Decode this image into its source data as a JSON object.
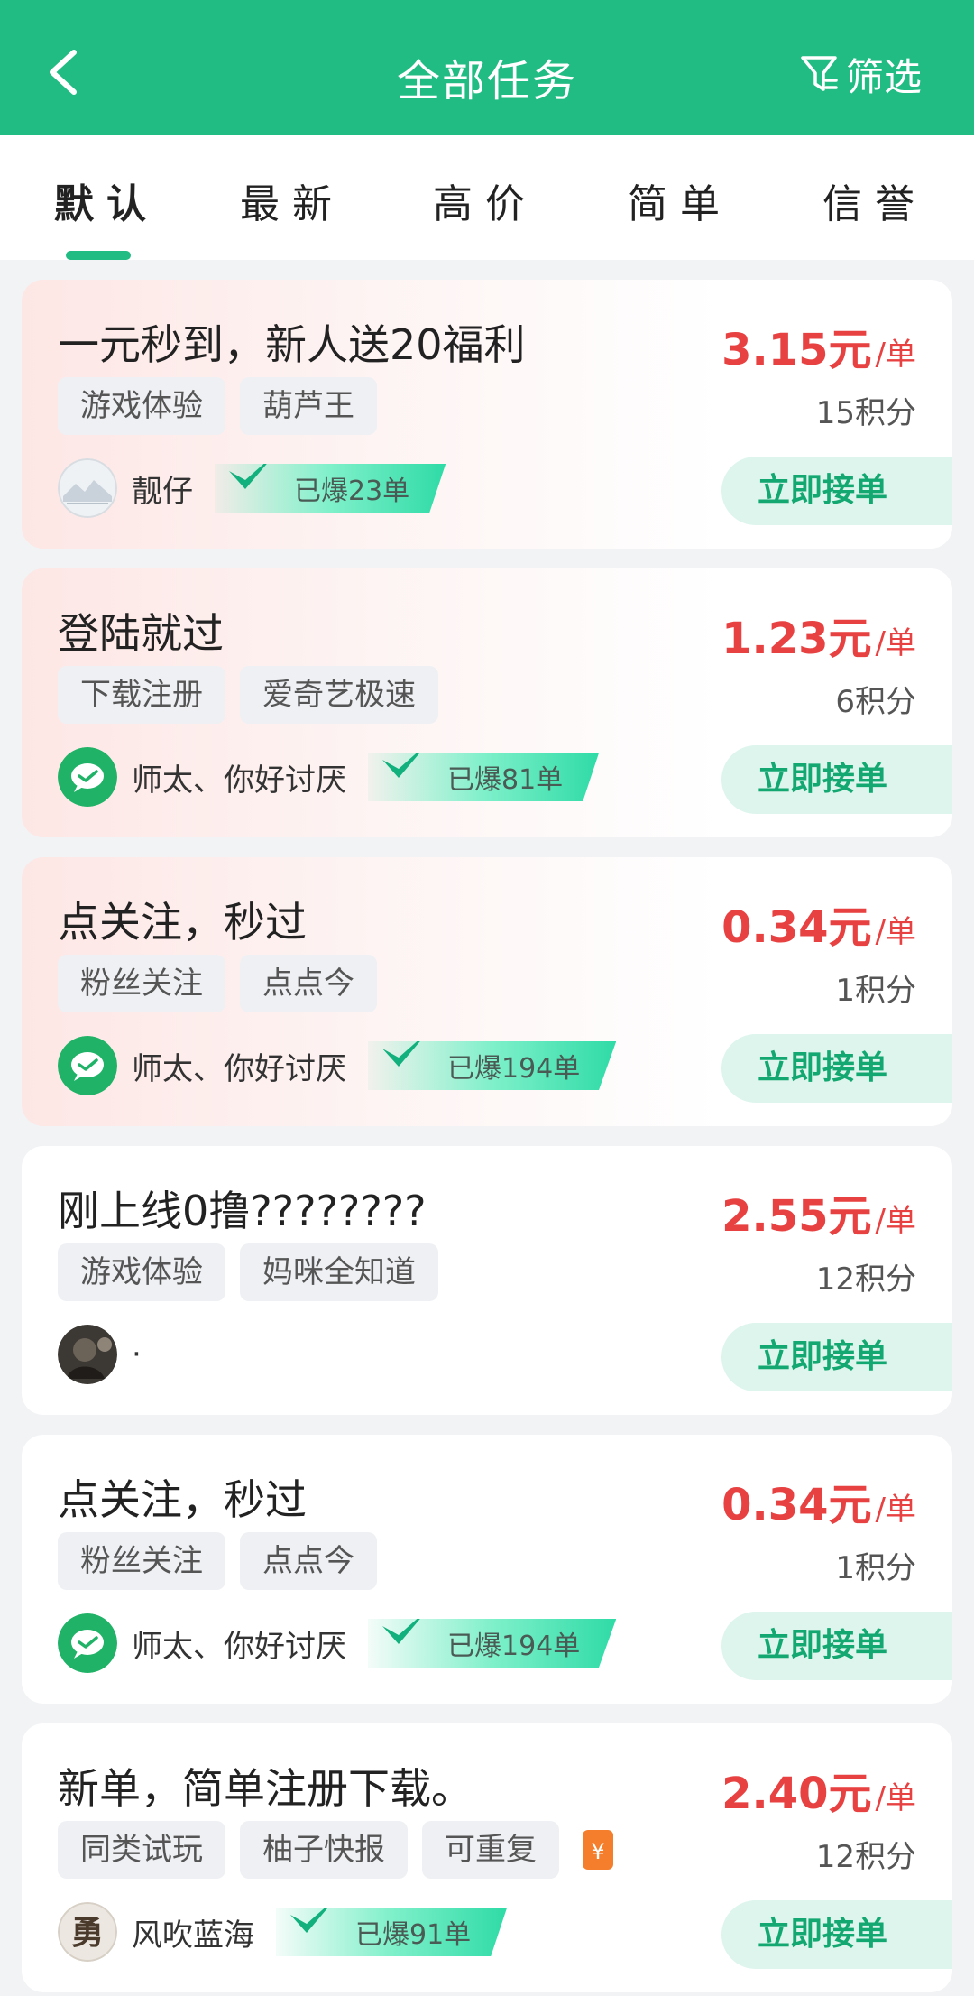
{
  "header": {
    "title": "全部任务",
    "filter_label": "筛选",
    "bg_color": "#21bc84"
  },
  "tabs": [
    {
      "label": "默认",
      "active": true
    },
    {
      "label": "最新",
      "active": false
    },
    {
      "label": "高价",
      "active": false
    },
    {
      "label": "简单",
      "active": false
    },
    {
      "label": "信誉",
      "active": false
    }
  ],
  "tasks": [
    {
      "title": "一元秒到，新人送20福利",
      "price": "3.15元",
      "unit": "/单",
      "tags": [
        "游戏体验",
        "葫芦王"
      ],
      "points": "15积分",
      "owner": "靓仔",
      "avatar": "landscape-avatar",
      "badge": "已爆23单",
      "action": "立即接单",
      "highlight": true
    },
    {
      "title": "登陆就过",
      "price": "1.23元",
      "unit": "/单",
      "tags": [
        "下载注册",
        "爱奇艺极速"
      ],
      "points": "6积分",
      "owner": "师太、你好讨厌",
      "avatar": "wechat-avatar",
      "badge": "已爆81单",
      "action": "立即接单",
      "highlight": true
    },
    {
      "title": "点关注，秒过",
      "price": "0.34元",
      "unit": "/单",
      "tags": [
        "粉丝关注",
        "点点今"
      ],
      "points": "1积分",
      "owner": "师太、你好讨厌",
      "avatar": "wechat-avatar",
      "badge": "已爆194单",
      "action": "立即接单",
      "highlight": true
    },
    {
      "title": "刚上线0撸????????",
      "price": "2.55元",
      "unit": "/单",
      "tags": [
        "游戏体验",
        "妈咪全知道"
      ],
      "points": "12积分",
      "owner": "·",
      "avatar": "dark-photo-avatar",
      "badge": "",
      "action": "立即接单",
      "highlight": false
    },
    {
      "title": "点关注，秒过",
      "price": "0.34元",
      "unit": "/单",
      "tags": [
        "粉丝关注",
        "点点今"
      ],
      "points": "1积分",
      "owner": "师太、你好讨厌",
      "avatar": "wechat-avatar",
      "badge": "已爆194单",
      "action": "立即接单",
      "highlight": false
    },
    {
      "title": "新单，简单注册下载。",
      "price": "2.40元",
      "unit": "/单",
      "tags": [
        "同类试玩",
        "柚子快报",
        "可重复"
      ],
      "tag_icon": "¥",
      "points": "12积分",
      "owner": "风吹蓝海",
      "avatar": "calligraphy-avatar",
      "avatar_text": "勇",
      "badge": "已爆91单",
      "action": "立即接单",
      "highlight": false
    }
  ],
  "colors": {
    "accent": "#21bc84",
    "price": "#e84141",
    "accept_bg": "#ddf5ec",
    "accept_text": "#13a872"
  }
}
